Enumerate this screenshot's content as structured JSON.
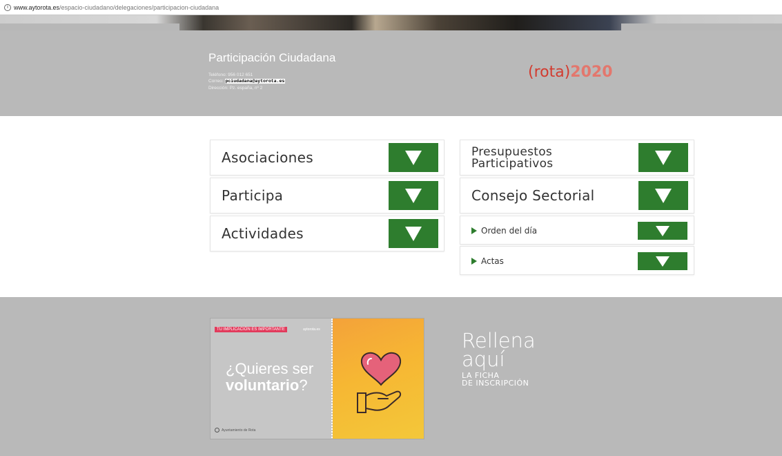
{
  "browser": {
    "url_host": "www.aytorota.es",
    "url_path": "/espacio-ciudadano/delegaciones/participacion-ciudadana"
  },
  "header": {
    "title": "Participación Ciudadana",
    "phone_line": "Teléfono: 956 012 651",
    "email_label": "Correo:",
    "email": "pciudadana@aytorota.es",
    "address_line": "Dirección: Pz. españa, nº 2",
    "logo_rota": "(rota)",
    "logo_year": "2020"
  },
  "left_menu": [
    {
      "label": "Asociaciones"
    },
    {
      "label": "Participa"
    },
    {
      "label": "Actividades"
    }
  ],
  "right_menu": {
    "presupuestos": "Presupuestos Participativos",
    "consejo": "Consejo Sectorial",
    "sub_items": [
      {
        "label": "Orden del día"
      },
      {
        "label": "Actas"
      }
    ]
  },
  "banner": {
    "tag": "TU IMPLICACIÓN ES IMPORTANTE",
    "tag_site": "aytorota.es",
    "question_1": "¿Quieres ser",
    "question_2": "voluntario",
    "question_mark": "?",
    "footer": "Ayuntamiento de Rota",
    "colors": {
      "tag": "#e23b5c",
      "heart": "#e5627a",
      "orange": "#f4a23a"
    }
  },
  "rellena": {
    "line1": "Rellena",
    "line2": "aquí",
    "line3": "LA FICHA",
    "line4": "DE INSCRIPCIÓN"
  },
  "colors": {
    "accent_green": "#2e7d2e",
    "band_gray": "#b9b9b9"
  }
}
